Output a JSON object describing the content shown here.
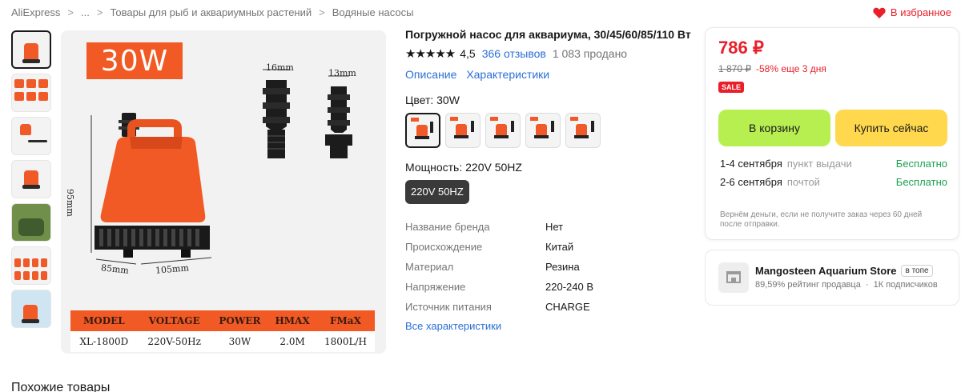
{
  "breadcrumb": {
    "items": [
      "AliExpress",
      "...",
      "Товары для рыб и аквариумных растений",
      "Водяные насосы"
    ],
    "separator": ">"
  },
  "favorite": {
    "label": "В избранное"
  },
  "image_text": {
    "badge": "30W",
    "dim_16": "16mm",
    "dim_13": "13mm",
    "dim_95": "95mm",
    "dim_85": "85mm",
    "dim_105": "105mm",
    "table_headers": [
      "MODEL",
      "VOLTAGE",
      "POWER",
      "HMAX",
      "FMaX"
    ],
    "table_row": [
      "XL-1800D",
      "220V-50Hz",
      "30W",
      "2.0M",
      "1800L/H"
    ]
  },
  "product": {
    "title": "Погружной насос для аквариума, 30/45/60/85/110 Вт",
    "stars": "★★★★★",
    "rating": "4,5",
    "reviews": "366 отзывов",
    "sold": "1 083 продано",
    "tabs": [
      "Описание",
      "Характеристики"
    ],
    "color_label": "Цвет: 30W",
    "power_label": "Мощность: 220V 50HZ",
    "power_option": "220V 50HZ",
    "properties": [
      {
        "key": "Название бренда",
        "value": "Нет"
      },
      {
        "key": "Происхождение",
        "value": "Китай"
      },
      {
        "key": "Материал",
        "value": "Резина"
      },
      {
        "key": "Напряжение",
        "value": "220-240 В"
      },
      {
        "key": "Источник питания",
        "value": "CHARGE"
      }
    ],
    "all_properties": "Все характеристики"
  },
  "buy": {
    "price": "786 ₽",
    "old_price": "1 870 ₽",
    "discount": "-58% еще 3 дня",
    "sale_badge": "SALE",
    "cart_button": "В корзину",
    "buy_button": "Купить сейчас",
    "shipping": [
      {
        "dates": "1-4 сентября",
        "method": "пункт выдачи",
        "price": "Бесплатно"
      },
      {
        "dates": "2-6 сентября",
        "method": "почтой",
        "price": "Бесплатно"
      }
    ],
    "refund": "Вернём деньги, если не получите заказ через 60 дней после отправки."
  },
  "store": {
    "name": "Mangosteen Aquarium Store",
    "badge": "в топе",
    "rating": "89,59% рейтинг продавца",
    "dot": "·",
    "followers": "1К подписчиков"
  },
  "similar_heading": "Похожие товары",
  "colors": {
    "accent_orange": "#f15a24",
    "price_red": "#e8202a",
    "link_blue": "#2a6fd6",
    "cart_green": "#b8ef50",
    "buy_yellow": "#ffd84d",
    "free_green": "#1aa152"
  }
}
